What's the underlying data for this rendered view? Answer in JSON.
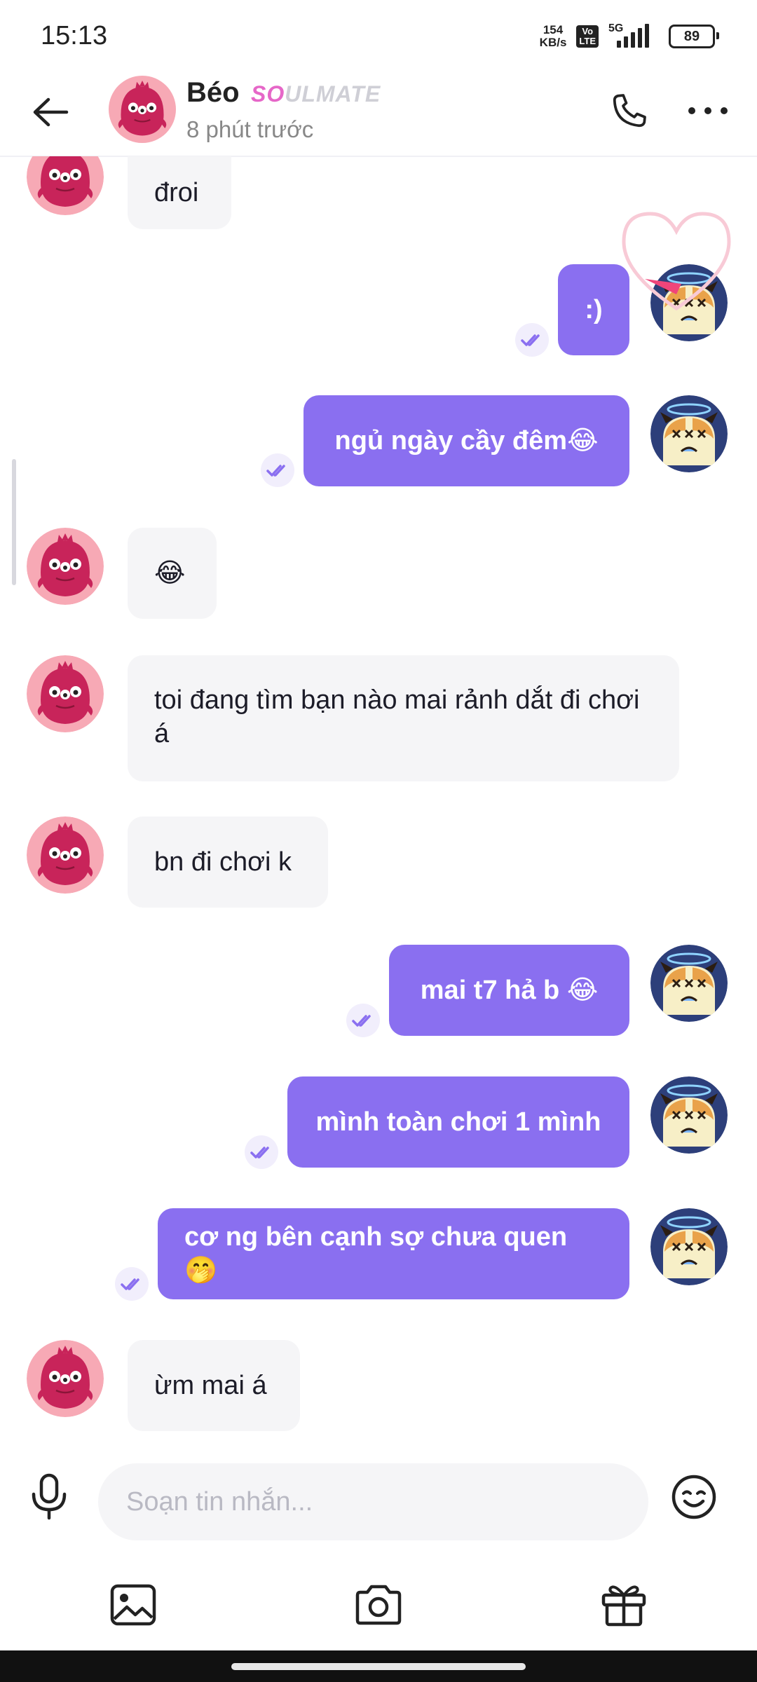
{
  "status_bar": {
    "time": "15:13",
    "net_speed_value": "154",
    "net_speed_unit": "KB/s",
    "volte_top": "Vo",
    "volte_bottom": "LTE",
    "network": "5G",
    "battery": "89"
  },
  "header": {
    "name": "Béo",
    "badge_so": "SO",
    "badge_rest": "ULMATE",
    "status": "8 phút trước"
  },
  "messages": [
    {
      "side": "in",
      "text": "đroi"
    },
    {
      "side": "out",
      "text": ":)"
    },
    {
      "side": "out",
      "text": "ngủ ngày cầy đêm😂"
    },
    {
      "side": "in",
      "text": "😂"
    },
    {
      "side": "in",
      "text": "toi đang tìm bạn nào mai rảnh dắt đi chơi á"
    },
    {
      "side": "in",
      "text": "bn đi chơi k"
    },
    {
      "side": "out",
      "text": "mai t7 hả b 😂"
    },
    {
      "side": "out",
      "text": "mình toàn chơi 1 mình"
    },
    {
      "side": "out",
      "text": "cơ ng bên cạnh sợ chưa quen 🤭"
    },
    {
      "side": "in",
      "text": "ừm mai á"
    }
  ],
  "composer": {
    "placeholder": "Soạn tin nhắn..."
  },
  "icons": {
    "back": "arrow-left-icon",
    "call": "phone-icon",
    "more": "more-horizontal-icon",
    "mic": "microphone-icon",
    "emoji": "smiley-icon",
    "image": "image-icon",
    "camera": "camera-icon",
    "gift": "gift-icon",
    "read": "double-check-icon"
  },
  "colors": {
    "outgoing_bubble": "#8a6ff0",
    "incoming_bubble": "#f5f5f7",
    "partner_avatar": "#c8245a",
    "soulmate_pink": "#e667c8"
  }
}
